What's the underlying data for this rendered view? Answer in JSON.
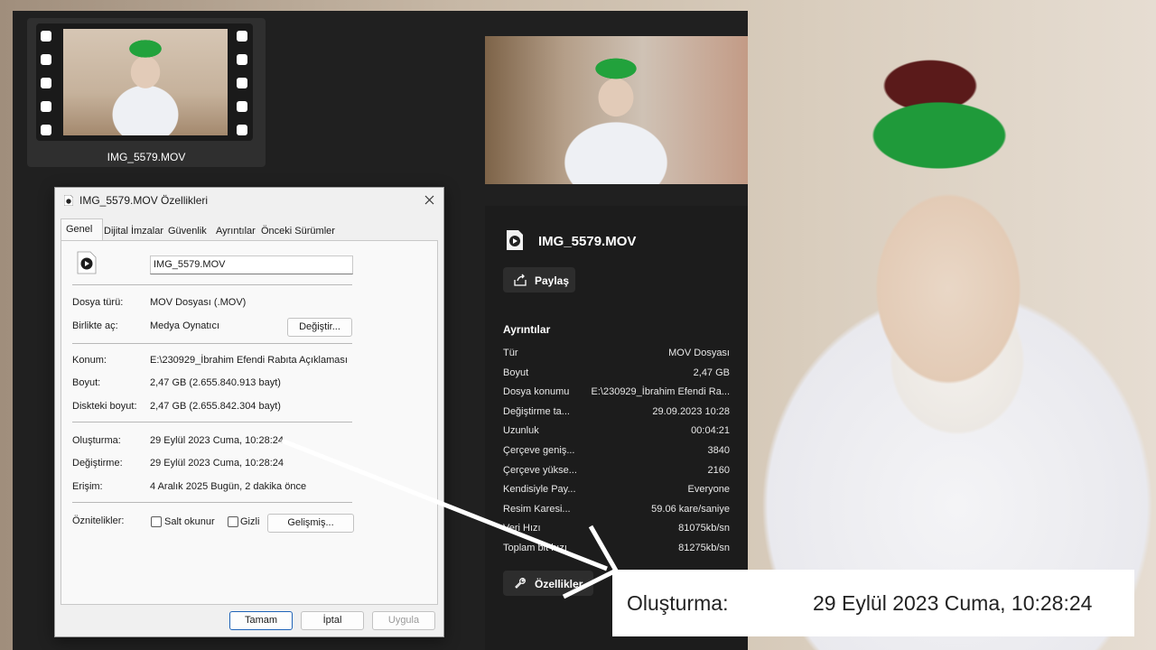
{
  "thumbnail": {
    "filename": "IMG_5579.MOV"
  },
  "dialog": {
    "title": "IMG_5579.MOV Özellikleri",
    "tabs": [
      "Genel",
      "Dijital İmzalar",
      "Güvenlik",
      "Ayrıntılar",
      "Önceki Sürümler"
    ],
    "name_field": "IMG_5579.MOV",
    "file_type_label": "Dosya türü:",
    "file_type_value": "MOV Dosyası (.MOV)",
    "opens_with_label": "Birlikte aç:",
    "opens_with_value": "Medya Oynatıcı",
    "change_button": "Değiştir...",
    "location_label": "Konum:",
    "location_value": "E:\\230929_İbrahim Efendi Rabıta Açıklaması",
    "size_label": "Boyut:",
    "size_value": "2,47 GB (2.655.840.913 bayt)",
    "disk_size_label": "Diskteki boyut:",
    "disk_size_value": "2,47 GB (2.655.842.304 bayt)",
    "created_label": "Oluşturma:",
    "created_value": "29 Eylül 2023 Cuma, 10:28:24",
    "modified_label": "Değiştirme:",
    "modified_value": "29 Eylül 2023 Cuma, 10:28:24",
    "accessed_label": "Erişim:",
    "accessed_value": "4 Aralık 2025 Bugün, 2 dakika önce",
    "attributes_label": "Öznitelikler:",
    "readonly_label": "Salt okunur",
    "hidden_label": "Gizli",
    "advanced_button": "Gelişmiş...",
    "ok_button": "Tamam",
    "cancel_button": "İptal",
    "apply_button": "Uygula"
  },
  "details_pane": {
    "filename": "IMG_5579.MOV",
    "share_button": "Paylaş",
    "section_title": "Ayrıntılar",
    "rows": [
      {
        "key": "Tür",
        "value": "MOV Dosyası"
      },
      {
        "key": "Boyut",
        "value": "2,47 GB"
      },
      {
        "key": "Dosya konumu",
        "value": "E:\\230929_İbrahim Efendi Ra..."
      },
      {
        "key": "Değiştirme ta...",
        "value": "29.09.2023 10:28"
      },
      {
        "key": "Uzunluk",
        "value": "00:04:21"
      },
      {
        "key": "Çerçeve geniş...",
        "value": "3840"
      },
      {
        "key": "Çerçeve yükse...",
        "value": "2160"
      },
      {
        "key": "Kendisiyle Pay...",
        "value": "Everyone"
      },
      {
        "key": "Resim Karesi...",
        "value": "59.06 kare/saniye"
      },
      {
        "key": "Veri Hızı",
        "value": "81075kb/sn"
      },
      {
        "key": "Toplam bit hızı",
        "value": "81275kb/sn"
      }
    ],
    "properties_button": "Özellikler"
  },
  "callout": {
    "label": "Oluşturma:",
    "value": "29 Eylül 2023 Cuma, 10:28:24"
  }
}
